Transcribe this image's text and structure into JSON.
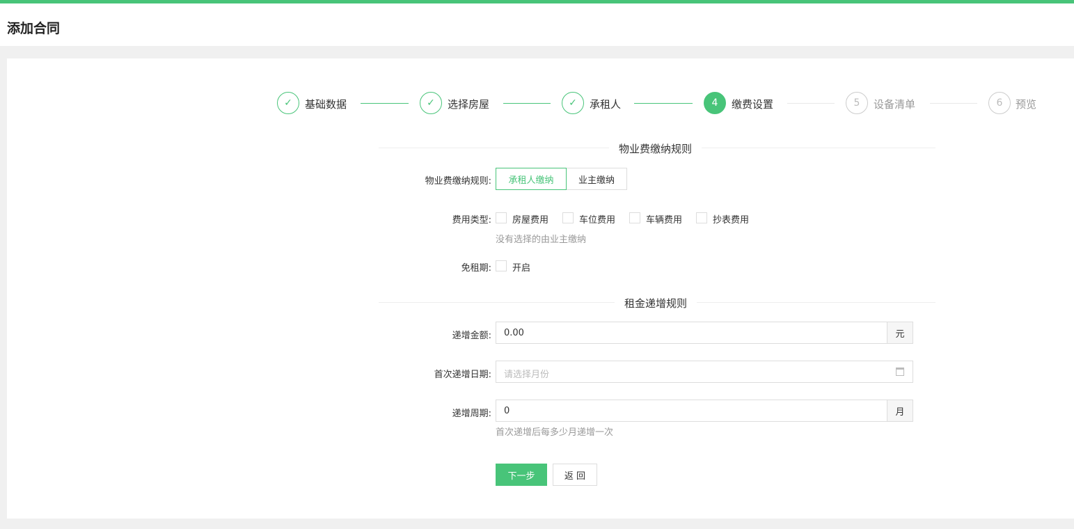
{
  "page": {
    "title": "添加合同"
  },
  "steps": [
    {
      "num": "1",
      "label": "基础数据",
      "status": "done"
    },
    {
      "num": "2",
      "label": "选择房屋",
      "status": "done"
    },
    {
      "num": "3",
      "label": "承租人",
      "status": "done"
    },
    {
      "num": "4",
      "label": "缴费设置",
      "status": "active"
    },
    {
      "num": "5",
      "label": "设备清单",
      "status": "todo"
    },
    {
      "num": "6",
      "label": "预览",
      "status": "todo"
    }
  ],
  "property": {
    "section_title": "物业费缴纳规则",
    "rule_label": "物业费缴纳规则:",
    "rule_options": [
      "承租人缴纳",
      "业主缴纳"
    ],
    "rule_selected": "承租人缴纳",
    "fee_type_label": "费用类型:",
    "fee_types": [
      "房屋费用",
      "车位费用",
      "车辆费用",
      "抄表费用"
    ],
    "fee_hint": "没有选择的由业主缴纳",
    "free_label": "免租期:",
    "free_option": "开启"
  },
  "rent": {
    "section_title": "租金递增规则",
    "amount_label": "递增金额:",
    "amount_value": "0.00",
    "amount_unit": "元",
    "date_label": "首次递增日期:",
    "date_placeholder": "请选择月份",
    "period_label": "递增周期:",
    "period_value": "0",
    "period_unit": "月",
    "period_hint": "首次递增后每多少月递增一次"
  },
  "buttons": {
    "next": "下一步",
    "back": "返 回"
  },
  "colors": {
    "accent": "#48c479"
  }
}
